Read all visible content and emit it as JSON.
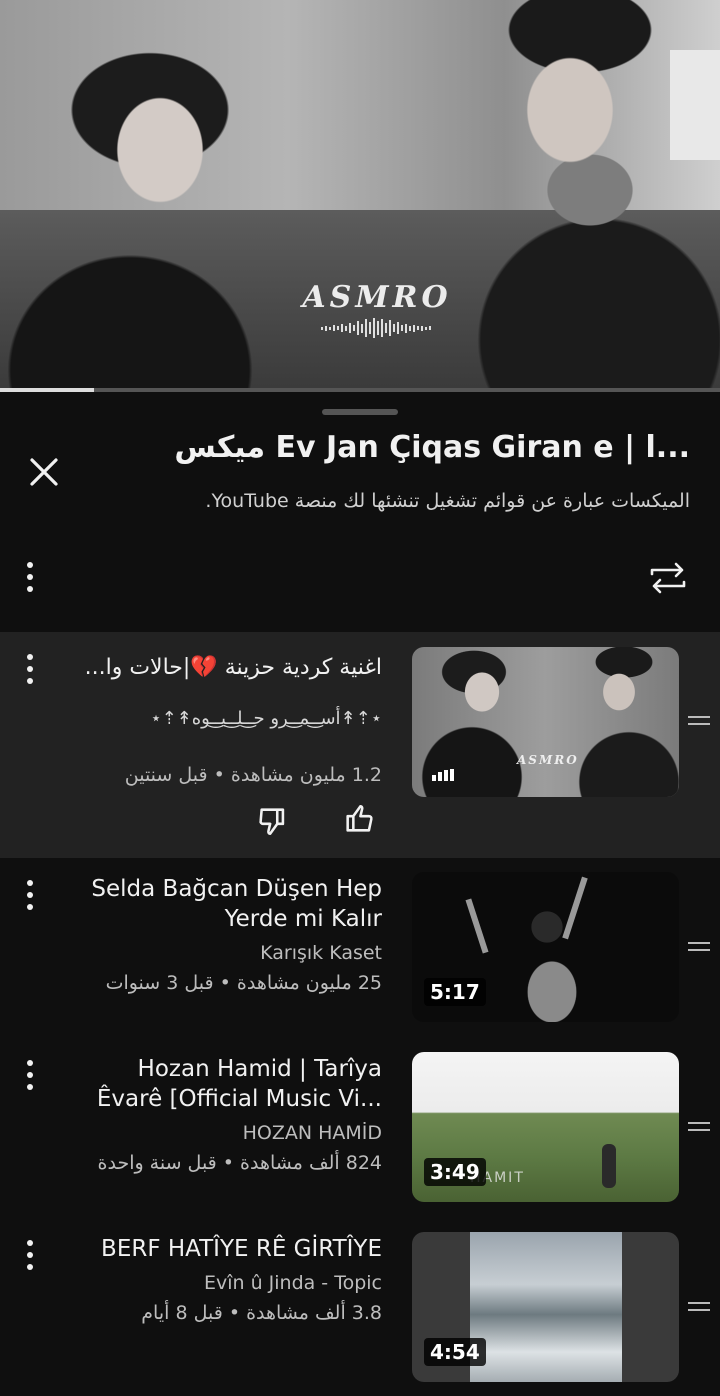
{
  "player": {
    "brand": "ASMRO",
    "progress": 0.13
  },
  "sheet": {
    "title": "ميكس Ev Jan Çiqas Giran e | ا...",
    "subtitle": "الميكسات عبارة عن قوائم تشغيل تنشئها لك منصة YouTube."
  },
  "items": [
    {
      "title": "اغنية كردية حزينة 💔|حالات وا...",
      "channel": "⋆⇡↟أسـ͜ـمـ͜ـرو حـ͜ـلـ͜ـيـ͜ـوه↟⇡⋆",
      "meta": "1.2 مليون مشاهدة • قبل سنتين",
      "thumb_brand": "ASMRO",
      "playing": true
    },
    {
      "title_line1": "Selda Bağcan Düşen Hep",
      "title_line2": "Yerde mi Kalır",
      "channel": "Karışık Kaset",
      "meta": "25 مليون مشاهدة • قبل 3 سنوات",
      "duration": "5:17"
    },
    {
      "title_line1": "Hozan Hamid | Tarîya",
      "title_line2": "Êvarê  [Official Music Vi...",
      "channel": "HOZAN HAMİD",
      "meta": "824 ألف مشاهدة • قبل سنة واحدة",
      "duration": "3:49",
      "thumb_ghost": "HAMIT"
    },
    {
      "title_line1": "BERF HATÎYE RÊ GİRTÎYE",
      "channel": "Evîn û Jinda - Topic",
      "meta": "3.8 ألف مشاهدة • قبل 8 أيام",
      "duration": "4:54"
    }
  ],
  "icons": {
    "close": "close-icon",
    "more": "more-vert-icon",
    "loop": "loop-icon",
    "like": "thumb-up-icon",
    "dislike": "thumb-down-icon",
    "drag": "drag-handle-icon"
  }
}
